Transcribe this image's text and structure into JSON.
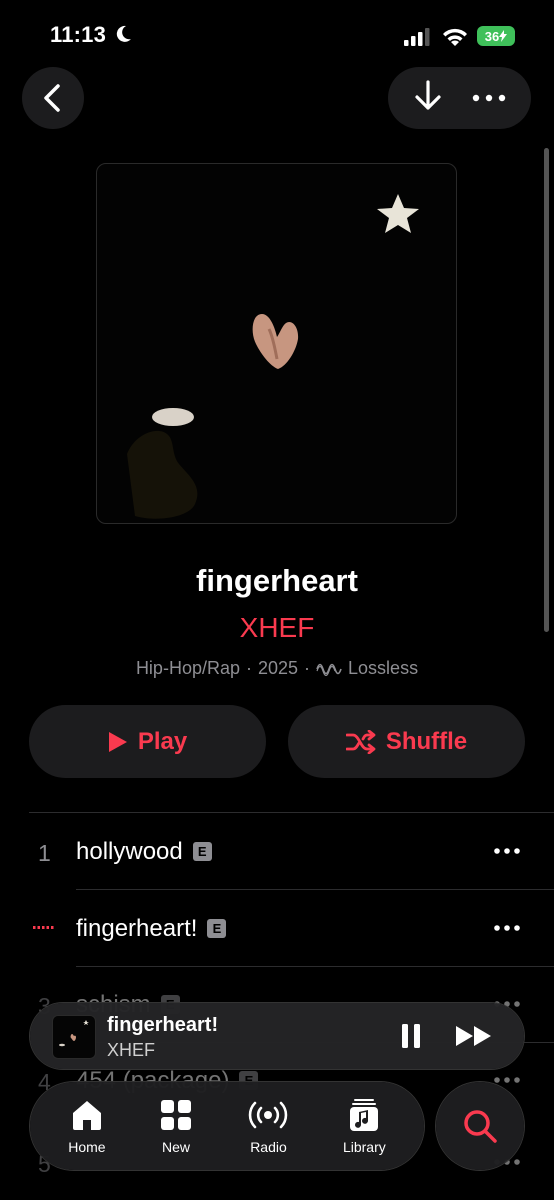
{
  "status_bar": {
    "time": "11:13",
    "battery": "36"
  },
  "album": {
    "title": "fingerheart",
    "artist": "XHEF",
    "genre": "Hip-Hop/Rap",
    "year": "2025",
    "quality": "Lossless",
    "separator": "·"
  },
  "actions": {
    "play": "Play",
    "shuffle": "Shuffle"
  },
  "tracks": [
    {
      "num": "1",
      "title": "hollywood",
      "explicit": "E",
      "playing": false
    },
    {
      "num": "",
      "title": "fingerheart!",
      "explicit": "E",
      "playing": true
    },
    {
      "num": "3",
      "title": "schism",
      "explicit": "E",
      "playing": false
    },
    {
      "num": "4",
      "title": "454 (package)",
      "explicit": "E",
      "playing": false
    },
    {
      "num": "5",
      "title": "",
      "explicit": "",
      "playing": false
    }
  ],
  "now_playing": {
    "title": "fingerheart!",
    "artist": "XHEF"
  },
  "tabs": [
    {
      "label": "Home",
      "icon": "home-icon"
    },
    {
      "label": "New",
      "icon": "grid-icon"
    },
    {
      "label": "Radio",
      "icon": "radio-icon"
    },
    {
      "label": "Library",
      "icon": "library-icon"
    }
  ],
  "colors": {
    "accent": "#fa3a4f",
    "background": "#000000",
    "surface": "#1c1c1e",
    "secondary_text": "#8e8e93"
  }
}
